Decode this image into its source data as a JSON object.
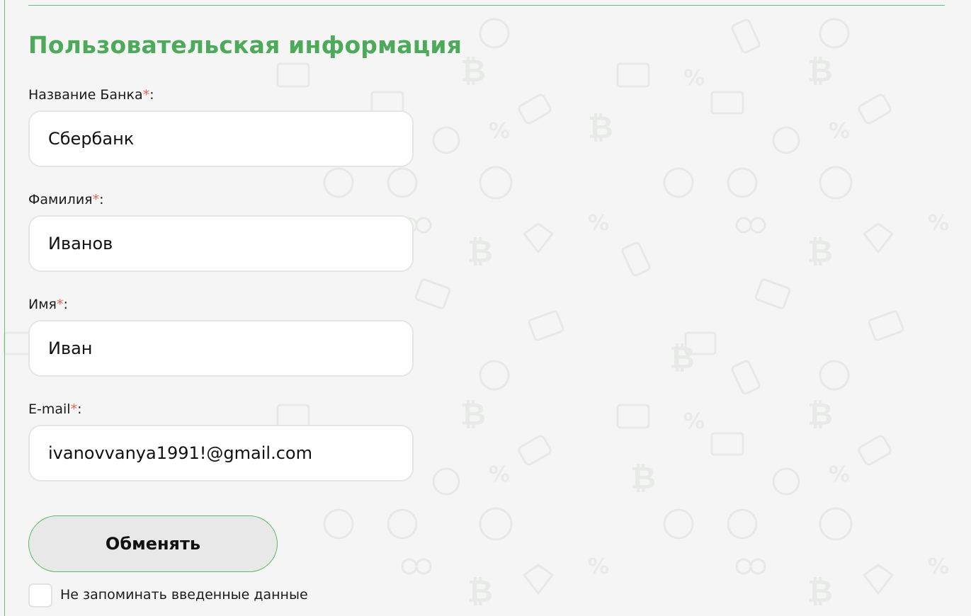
{
  "form": {
    "title": "Пользовательская информация",
    "required_mark": "*",
    "fields": [
      {
        "label": "Название Банка",
        "value": "Сбербанк"
      },
      {
        "label": "Фамилия",
        "value": "Иванов"
      },
      {
        "label": "Имя",
        "value": "Иван"
      },
      {
        "label": "E-mail",
        "value": "ivanovvanya1991!@gmail.com"
      }
    ],
    "submit_label": "Обменять",
    "checkbox_label": "Не запоминать введенные данные",
    "checkbox_checked": false
  },
  "colors": {
    "accent": "#4caa5a",
    "required": "#e2675c",
    "border": "#6cbf72",
    "background": "#f4f5f4"
  },
  "background_icons": [
    "bitcoin-icon",
    "dollar-coin-icon",
    "percent-icon",
    "euro-icon",
    "wallet-icon",
    "diamond-icon",
    "laptop-icon",
    "briefcase-icon",
    "tag-icon",
    "coins-icon"
  ]
}
